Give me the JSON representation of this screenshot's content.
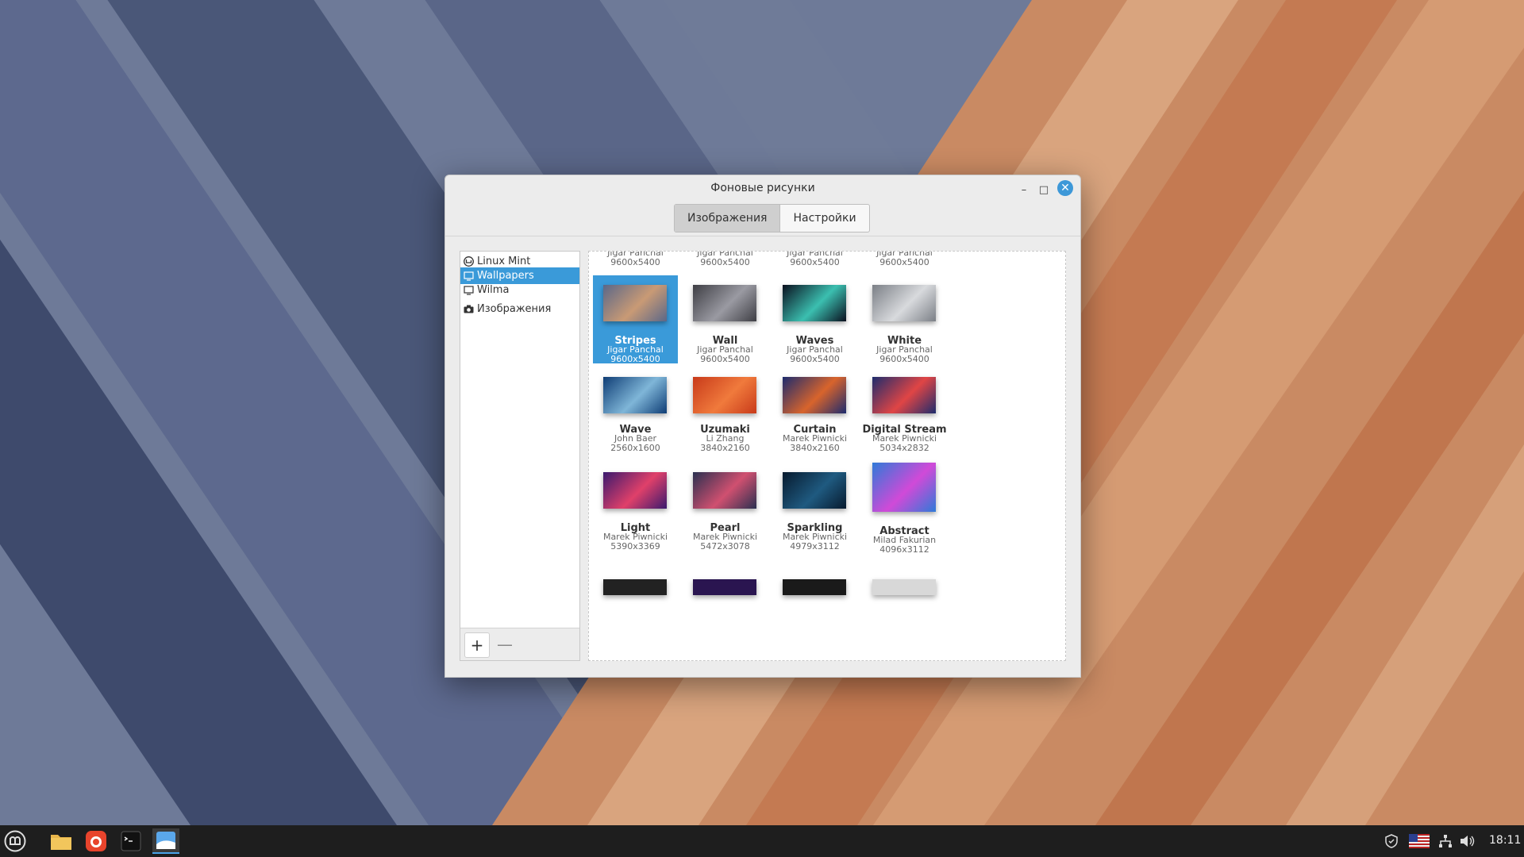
{
  "window": {
    "title": "Фоновые рисунки",
    "tabs": [
      {
        "label": "Изображения",
        "active": true
      },
      {
        "label": "Настройки",
        "active": false
      }
    ],
    "controls": {
      "minimize": "–",
      "maximize": "□",
      "close": "✕"
    }
  },
  "sidebar": {
    "items": [
      {
        "label": "Linux Mint",
        "icon": "mint-logo-icon",
        "selected": false
      },
      {
        "label": "Wallpapers",
        "icon": "monitor-icon",
        "selected": true
      },
      {
        "label": "Wilma",
        "icon": "monitor-icon",
        "selected": false
      },
      {
        "label": "Изображения",
        "icon": "camera-icon",
        "selected": false
      }
    ],
    "add_label": "+",
    "remove_label": "—"
  },
  "partial_row": [
    {
      "author": "Jigar Panchal",
      "res": "9600x5400"
    },
    {
      "author": "Jigar Panchal",
      "res": "9600x5400"
    },
    {
      "author": "Jigar Panchal",
      "res": "9600x5400"
    },
    {
      "author": "Jigar Panchal",
      "res": "9600x5400"
    }
  ],
  "wallpapers": [
    {
      "name": "Stripes",
      "author": "Jigar Panchal",
      "res": "9600x5400",
      "selected": true,
      "colors": [
        "#5b6788",
        "#c99a75"
      ]
    },
    {
      "name": "Wall",
      "author": "Jigar Panchal",
      "res": "9600x5400",
      "colors": [
        "#3e3e44",
        "#9a9aa2"
      ]
    },
    {
      "name": "Waves",
      "author": "Jigar Panchal",
      "res": "9600x5400",
      "colors": [
        "#0a0f1e",
        "#3bbfb0"
      ]
    },
    {
      "name": "White",
      "author": "Jigar Panchal",
      "res": "9600x5400",
      "colors": [
        "#7b7f86",
        "#d8dadd"
      ]
    },
    {
      "name": "Wave",
      "author": "John Baer",
      "res": "2560x1600",
      "colors": [
        "#0f3d75",
        "#7fb6d8"
      ]
    },
    {
      "name": "Uzumaki",
      "author": "Li Zhang",
      "res": "3840x2160",
      "colors": [
        "#c83a1a",
        "#f07a3c"
      ]
    },
    {
      "name": "Curtain",
      "author": "Marek Piwnicki",
      "res": "3840x2160",
      "colors": [
        "#1c2b6e",
        "#d8642c"
      ]
    },
    {
      "name": "Digital Stream",
      "author": "Marek Piwnicki",
      "res": "5034x2832",
      "colors": [
        "#1d2c6d",
        "#e04545"
      ]
    },
    {
      "name": "Light",
      "author": "Marek Piwnicki",
      "res": "5390x3369",
      "colors": [
        "#3a1a6e",
        "#e0406a"
      ]
    },
    {
      "name": "Pearl",
      "author": "Marek Piwnicki",
      "res": "5472x3078",
      "colors": [
        "#2a3050",
        "#d05070"
      ]
    },
    {
      "name": "Sparkling",
      "author": "Marek Piwnicki",
      "res": "4979x3112",
      "colors": [
        "#071a2e",
        "#1f5a80"
      ]
    },
    {
      "name": "Abstract",
      "author": "Milad Fakurian",
      "res": "4096x3112",
      "colors": [
        "#2f7ad8",
        "#d04ad8"
      ]
    }
  ],
  "bottom_row_colors": [
    "#222222",
    "#2a1550",
    "#1a1a1a",
    "#d8d8d8"
  ],
  "taskbar": {
    "apps": [
      "menu-icon",
      "files-icon",
      "firefox-icon",
      "terminal-icon",
      "wallpaper-app-icon"
    ],
    "tray": [
      "shield-icon",
      "us-flag-icon",
      "network-icon",
      "volume-icon"
    ],
    "clock": "18:11"
  }
}
